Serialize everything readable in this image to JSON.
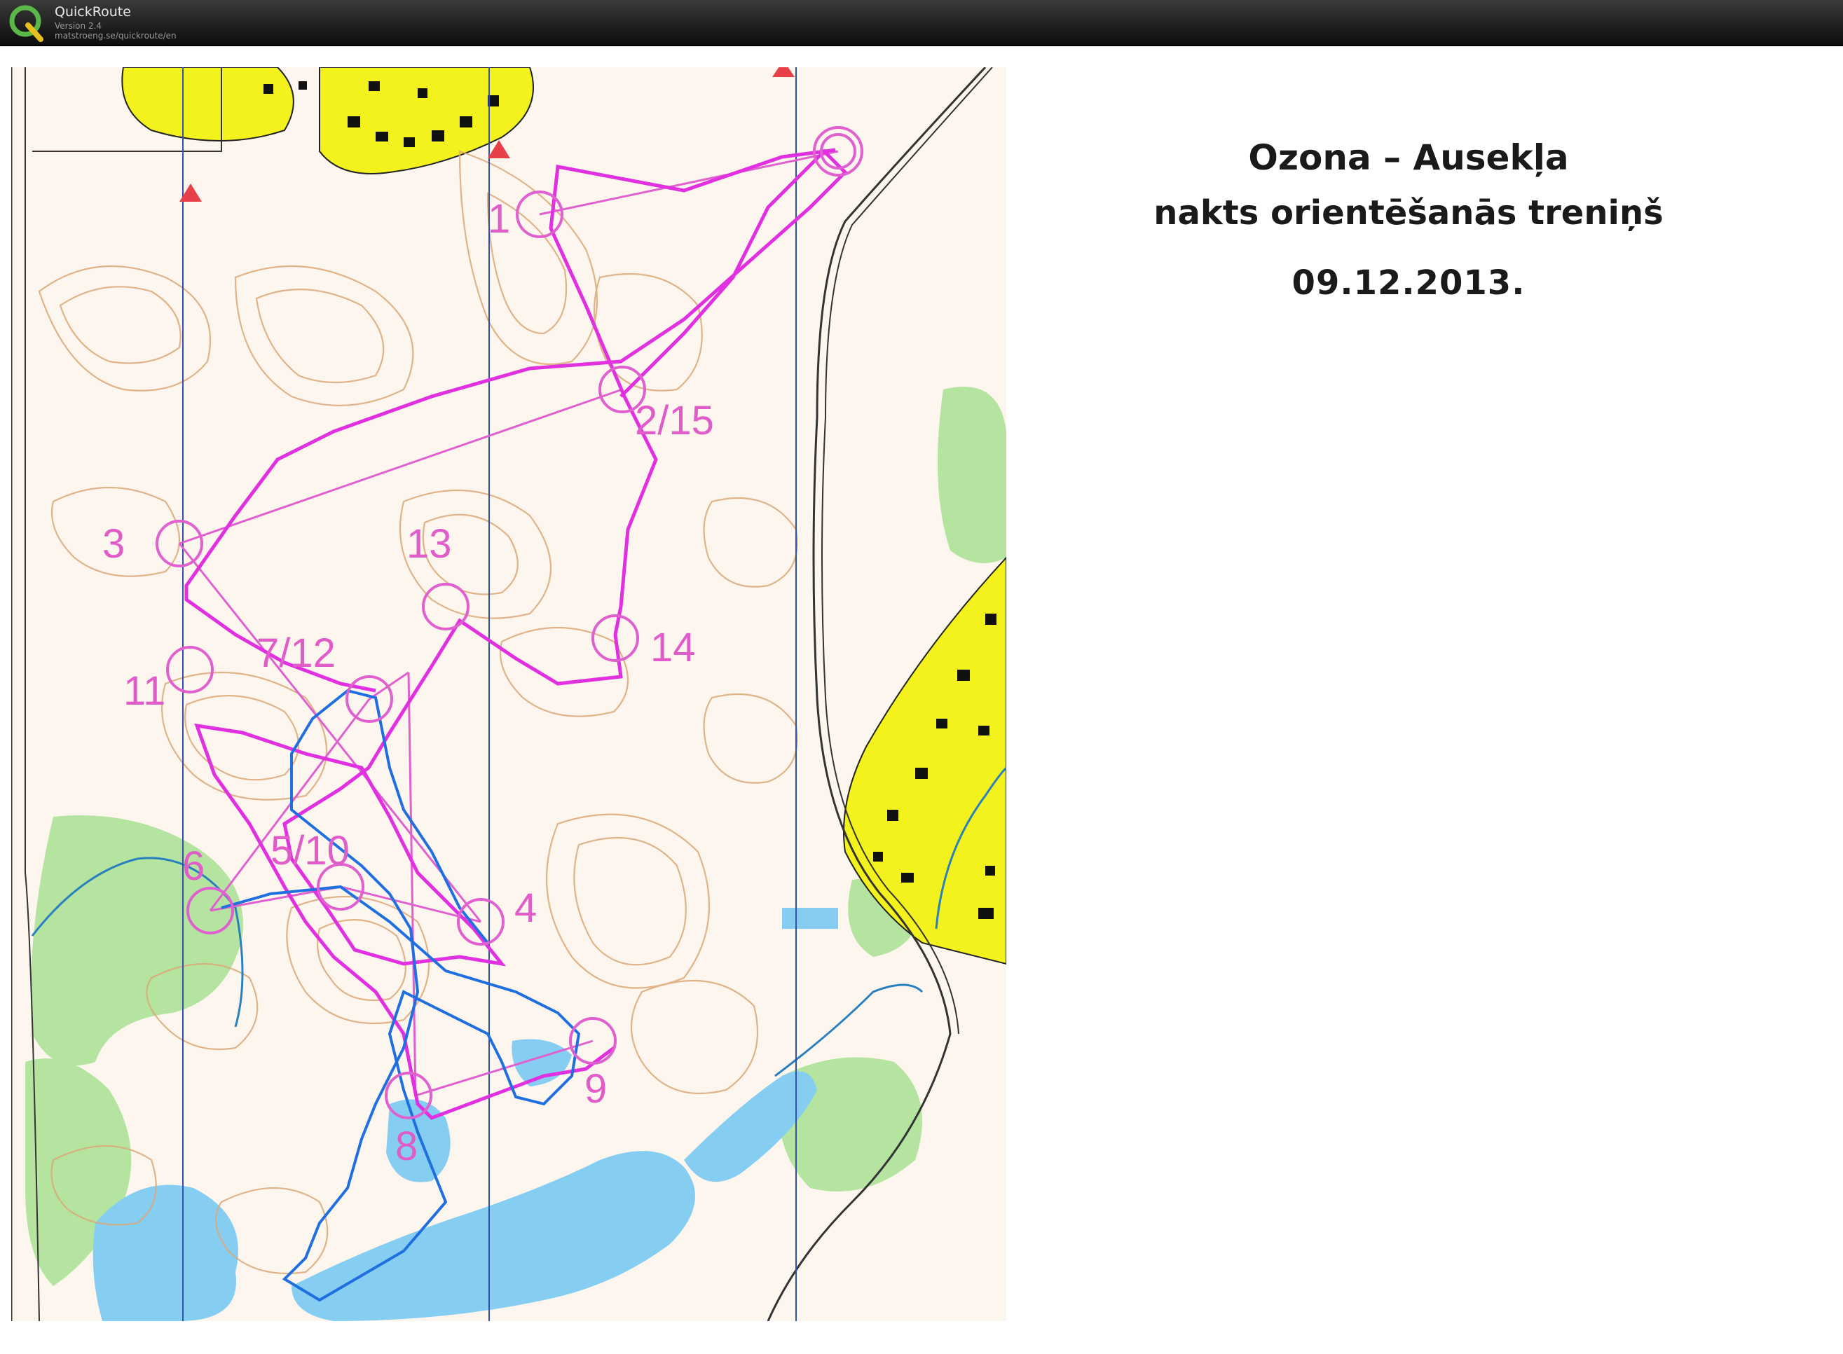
{
  "app": {
    "name": "QuickRoute",
    "version": "Version 2.4",
    "url": "matstroeng.se/quickroute/en",
    "logo_icon": "quickroute-q-logo"
  },
  "map_title": {
    "line1": "Ozona – Ausekļa",
    "line2": "nakts orientēšanās treniņš",
    "date": "09.12.2013."
  },
  "colors": {
    "course": "#e040d8",
    "route": "#1a73e8",
    "label": "#e05cc8",
    "settlement": "#f0f020",
    "water": "#7ec9f0",
    "vegetation": "#aee29a",
    "contour": "#d8a070",
    "meridian": "#2040a0"
  },
  "controls": [
    {
      "label": "1"
    },
    {
      "label": "2/15"
    },
    {
      "label": "3"
    },
    {
      "label": "4"
    },
    {
      "label": "5/10"
    },
    {
      "label": "6"
    },
    {
      "label": "7/12"
    },
    {
      "label": "8"
    },
    {
      "label": "9"
    },
    {
      "label": "11"
    },
    {
      "label": "13"
    },
    {
      "label": "14"
    }
  ]
}
